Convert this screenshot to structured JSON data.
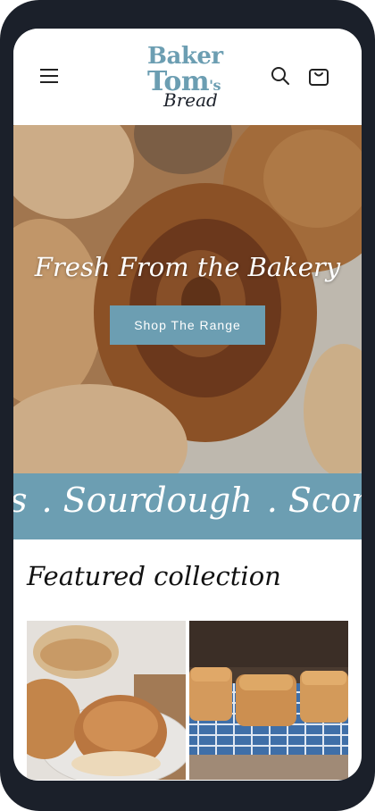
{
  "header": {
    "logo": {
      "line1": "Baker",
      "line2": "Tom",
      "line2_suffix": "'s",
      "line3": "Bread"
    }
  },
  "hero": {
    "title": "Fresh From the Bakery",
    "button_label": "Shop The Range"
  },
  "marquee": {
    "items": [
      "s",
      ". Sourdough",
      ". Scones"
    ]
  },
  "featured": {
    "title": "Featured collection"
  },
  "colors": {
    "accent": "#6c9eb2",
    "dark": "#1b202a"
  }
}
